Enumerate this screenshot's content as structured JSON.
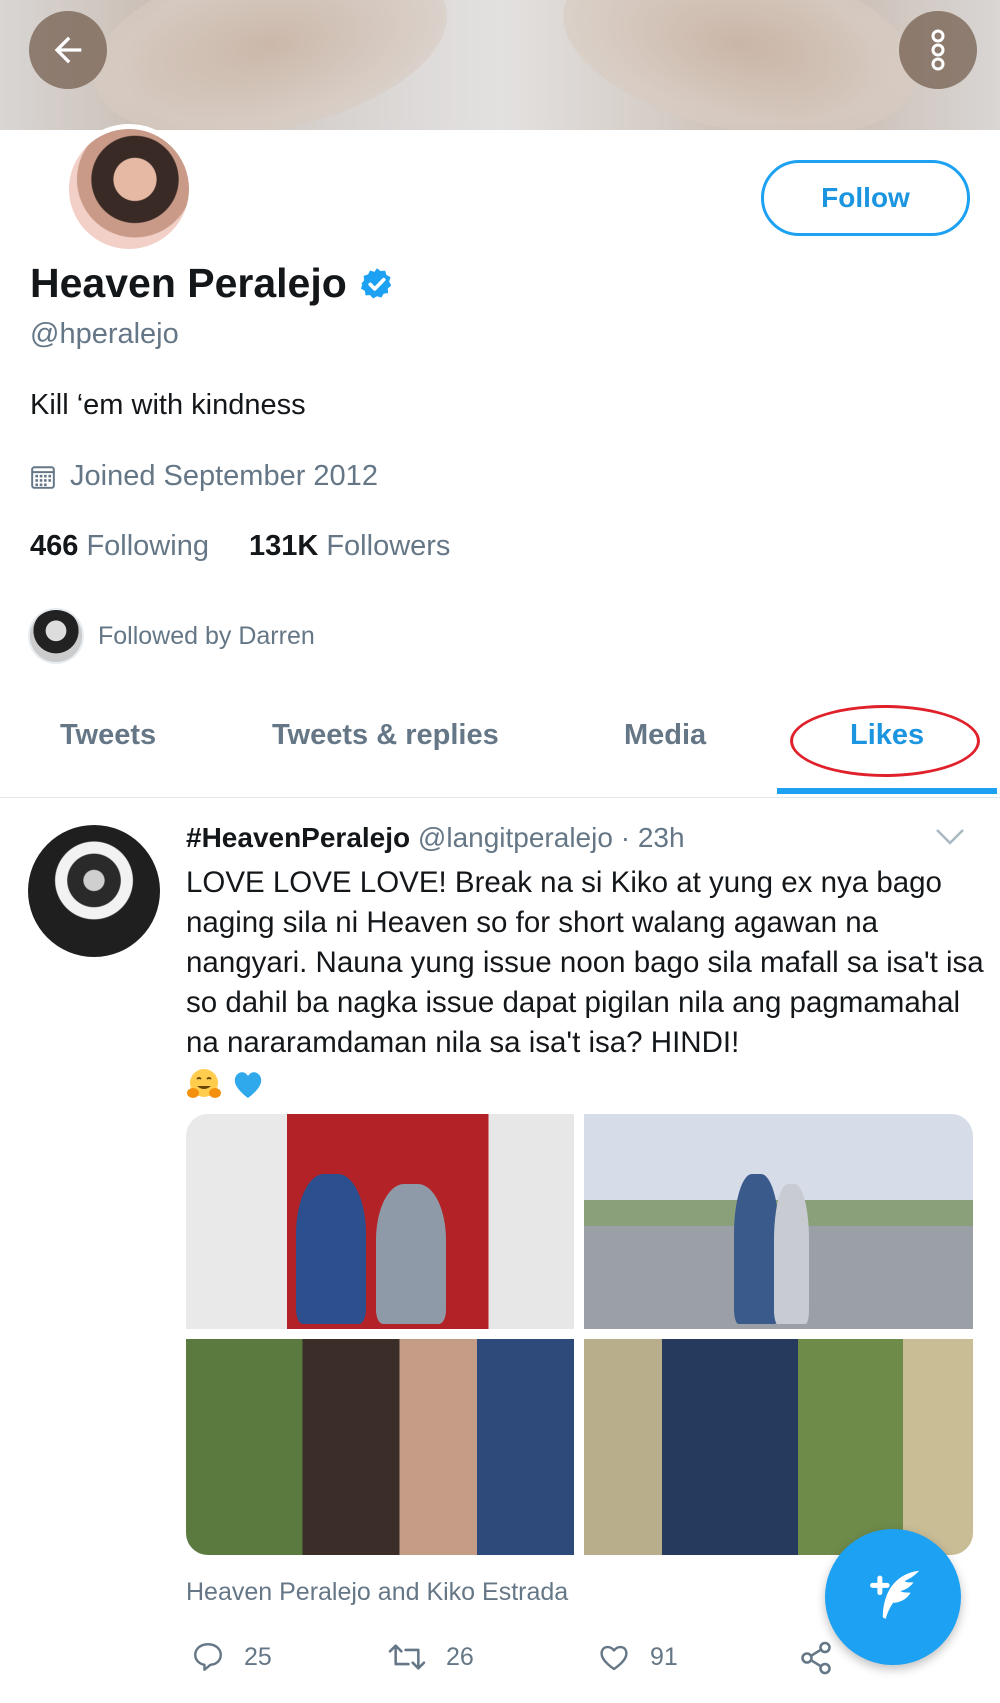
{
  "profile": {
    "name": "Heaven Peralejo",
    "handle": "@hperalejo",
    "bio": "Kill ‘em with kindness",
    "joined": "Joined September 2012",
    "following_count": "466",
    "following_label": "Following",
    "followers_count": "131K",
    "followers_label": "Followers",
    "followed_by": "Followed by Darren",
    "follow_button": "Follow"
  },
  "tabs": [
    {
      "label": "Tweets"
    },
    {
      "label": "Tweets & replies"
    },
    {
      "label": "Media"
    },
    {
      "label": "Likes",
      "active": true
    }
  ],
  "tweet": {
    "author_name": "#HeavenPeralejo",
    "author_handle": "@langitperalejo",
    "separator": "·",
    "time": "23h",
    "text": "LOVE LOVE LOVE! Break na si Kiko at yung ex nya bago naging sila ni Heaven so for short walang agawan na nangyari. Nauna yung issue noon bago sila mafall sa isa't isa so dahil ba nagka issue dapat pigilan nila ang pagmamahal na nararamdaman nila sa isa't isa? HINDI!",
    "emojis": [
      "hugging-face",
      "blue-heart"
    ],
    "media_caption": "Heaven Peralejo and Kiko Estrada",
    "replies": "25",
    "retweets": "26",
    "likes": "91"
  },
  "colors": {
    "accent": "#1da1f2",
    "accent_text": "#1b95e0",
    "secondary_text": "#657786",
    "primary_text": "#14171a",
    "annotation_circle": "#e0202a"
  }
}
